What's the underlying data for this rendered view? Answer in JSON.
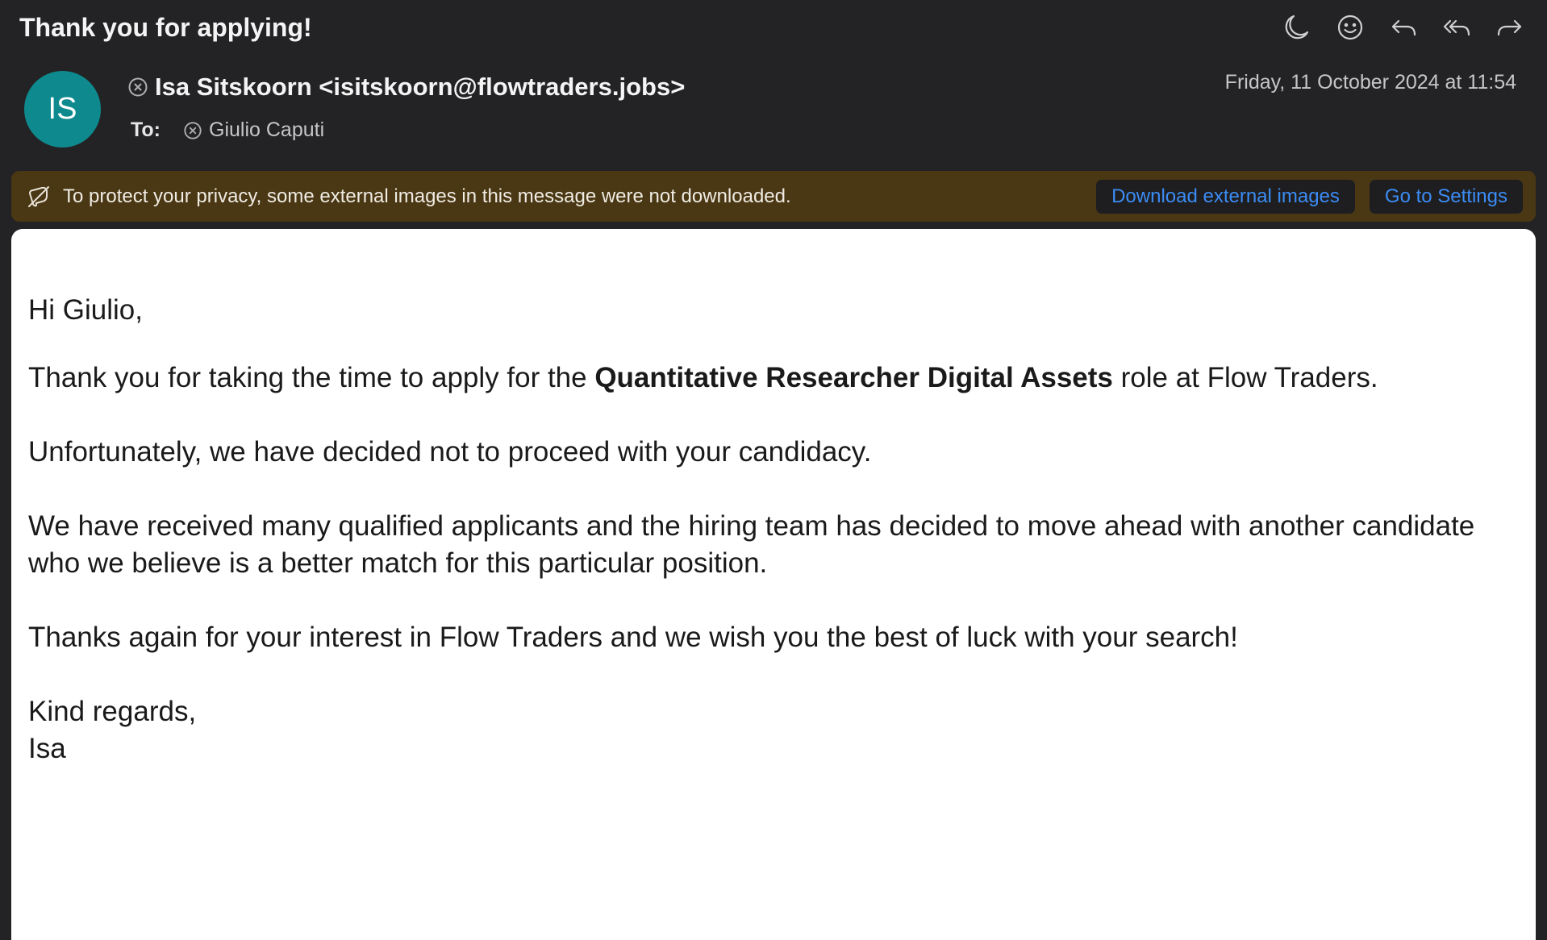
{
  "email": {
    "subject": "Thank you for applying!",
    "sender": {
      "initials": "IS",
      "display": "Isa Sitskoorn <isitskoorn@flowtraders.jobs>"
    },
    "date": "Friday, 11 October 2024 at 11:54",
    "to_label": "To:",
    "recipient": "Giulio Caputi"
  },
  "toolbar": {
    "icons": [
      "moon-icon",
      "smiley-icon",
      "reply-icon",
      "reply-all-icon",
      "forward-icon"
    ]
  },
  "privacy_banner": {
    "text": "To protect your privacy, some external images in this message were not downloaded.",
    "download_label": "Download external images",
    "settings_label": "Go to Settings"
  },
  "body": {
    "greeting": "Hi Giulio,",
    "p1_before": "Thank you for taking the time to apply for the ",
    "p1_role": "Quantitative Researcher Digital Assets",
    "p1_after": " role at Flow Traders.",
    "p2": "Unfortunately, we have decided not to proceed with your candidacy.",
    "p3": "We have received many qualified applicants and the hiring team has decided to move ahead with another candidate who we believe is a better match for this particular position.",
    "p4": "Thanks again for your interest in Flow Traders and we wish you the best of luck with your search!",
    "signoff": "Kind regards,",
    "signature": "Isa"
  },
  "colors": {
    "background": "#232325",
    "avatar": "#0e8a8e",
    "banner": "#4a3713",
    "link_blue": "#3b8cf5"
  }
}
